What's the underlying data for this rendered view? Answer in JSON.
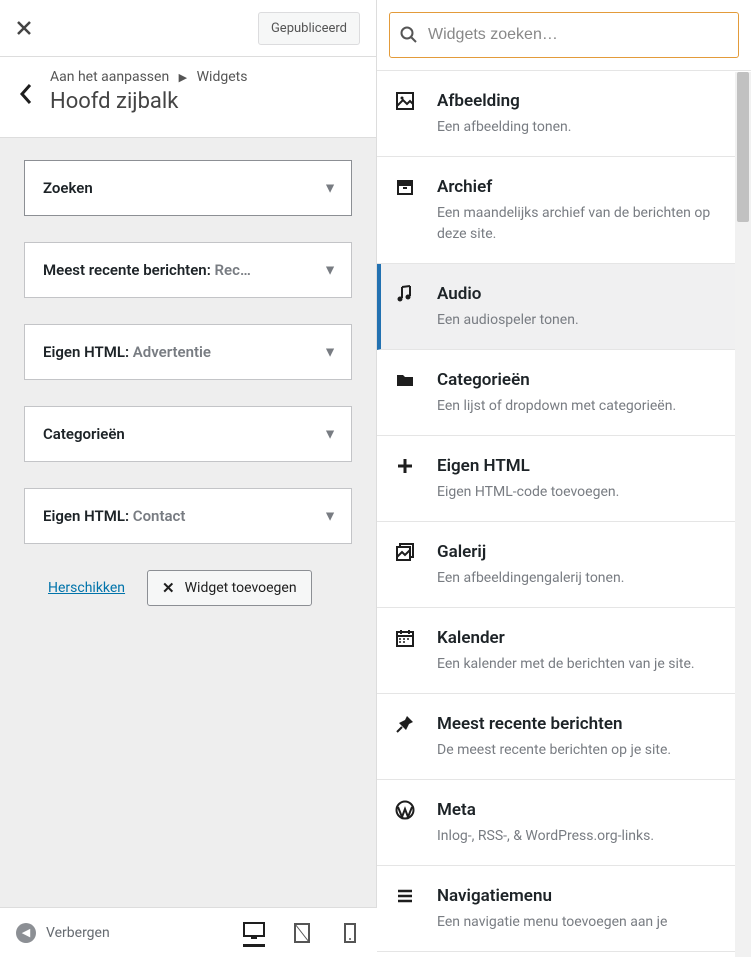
{
  "header": {
    "publish_status": "Gepubliceerd",
    "breadcrumb_prefix": "Aan het aanpassen",
    "breadcrumb_current": "Widgets",
    "title": "Hoofd zijbalk"
  },
  "sidebar_widgets": [
    {
      "name": "Zoeken",
      "sub": ""
    },
    {
      "name": "Meest recente berichten",
      "sub": "Rec…"
    },
    {
      "name": "Eigen HTML",
      "sub": "Advertentie"
    },
    {
      "name": "Categorieën",
      "sub": ""
    },
    {
      "name": "Eigen HTML",
      "sub": "Contact"
    }
  ],
  "actions": {
    "reorder": "Herschikken",
    "add_widget": "Widget toevoegen"
  },
  "footer": {
    "collapse": "Verbergen"
  },
  "search": {
    "placeholder": "Widgets zoeken…"
  },
  "available_widgets": [
    {
      "icon": "image",
      "title": "Afbeelding",
      "desc": "Een afbeelding tonen."
    },
    {
      "icon": "archive",
      "title": "Archief",
      "desc": "Een maandelijks archief van de berichten op deze site."
    },
    {
      "icon": "audio",
      "title": "Audio",
      "desc": "Een audiospeler tonen.",
      "hover": true
    },
    {
      "icon": "folder",
      "title": "Categorieën",
      "desc": "Een lijst of dropdown met categorieën."
    },
    {
      "icon": "plus",
      "title": "Eigen HTML",
      "desc": "Eigen HTML-code toevoegen."
    },
    {
      "icon": "gallery",
      "title": "Galerij",
      "desc": "Een afbeeldingengalerij tonen."
    },
    {
      "icon": "calendar",
      "title": "Kalender",
      "desc": "Een kalender met de berichten van je site."
    },
    {
      "icon": "pin",
      "title": "Meest recente berichten",
      "desc": "De meest recente berichten op je site."
    },
    {
      "icon": "wordpress",
      "title": "Meta",
      "desc": "Inlog-, RSS-, & WordPress.org-links."
    },
    {
      "icon": "menu",
      "title": "Navigatiemenu",
      "desc": "Een navigatie menu toevoegen aan je"
    }
  ]
}
